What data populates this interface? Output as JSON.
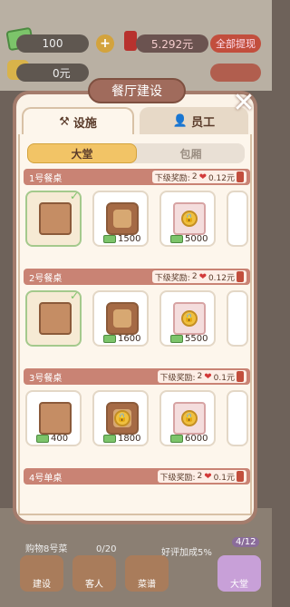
{
  "hud": {
    "cash_value": "100",
    "plus_label": "+",
    "red_value": "5.292元",
    "withdraw_label": "全部提现",
    "yuan_value": "0元"
  },
  "dialog": {
    "title": "餐厅建设",
    "close_label": "✕",
    "tabs": [
      {
        "label": "设施",
        "icon": "tools-icon"
      },
      {
        "label": "员工",
        "icon": "person-icon"
      }
    ],
    "subtabs": [
      {
        "label": "大堂"
      },
      {
        "label": "包厢"
      }
    ]
  },
  "sections": [
    {
      "name": "1号餐桌",
      "reward_label": "下级奖励:",
      "reward_hearts": "2",
      "reward_money": "0.12元",
      "items": [
        {
          "owned": true,
          "price": ""
        },
        {
          "owned": false,
          "price": "1500"
        },
        {
          "owned": false,
          "price": "5000",
          "locked": true
        },
        {
          "owned": false,
          "price": ""
        }
      ]
    },
    {
      "name": "2号餐桌",
      "reward_label": "下级奖励:",
      "reward_hearts": "2",
      "reward_money": "0.12元",
      "items": [
        {
          "owned": true,
          "price": ""
        },
        {
          "owned": false,
          "price": "1600"
        },
        {
          "owned": false,
          "price": "5500",
          "locked": true
        },
        {
          "owned": false,
          "price": ""
        }
      ]
    },
    {
      "name": "3号餐桌",
      "reward_label": "下级奖励:",
      "reward_hearts": "2",
      "reward_money": "0.1元",
      "items": [
        {
          "owned": false,
          "price": "400"
        },
        {
          "owned": false,
          "price": "1800",
          "locked": true
        },
        {
          "owned": false,
          "price": "6000",
          "locked": true
        },
        {
          "owned": false,
          "price": ""
        }
      ]
    },
    {
      "name": "4号单桌",
      "reward_label": "下级奖励:",
      "reward_hearts": "2",
      "reward_money": "0.1元",
      "items": []
    }
  ],
  "bottom": {
    "note": "购物8号菜",
    "count1": "0/20",
    "rating": "好评加成5%",
    "count2": "4/12",
    "buttons": [
      "建设",
      "客人",
      "菜谱",
      "大堂"
    ]
  }
}
